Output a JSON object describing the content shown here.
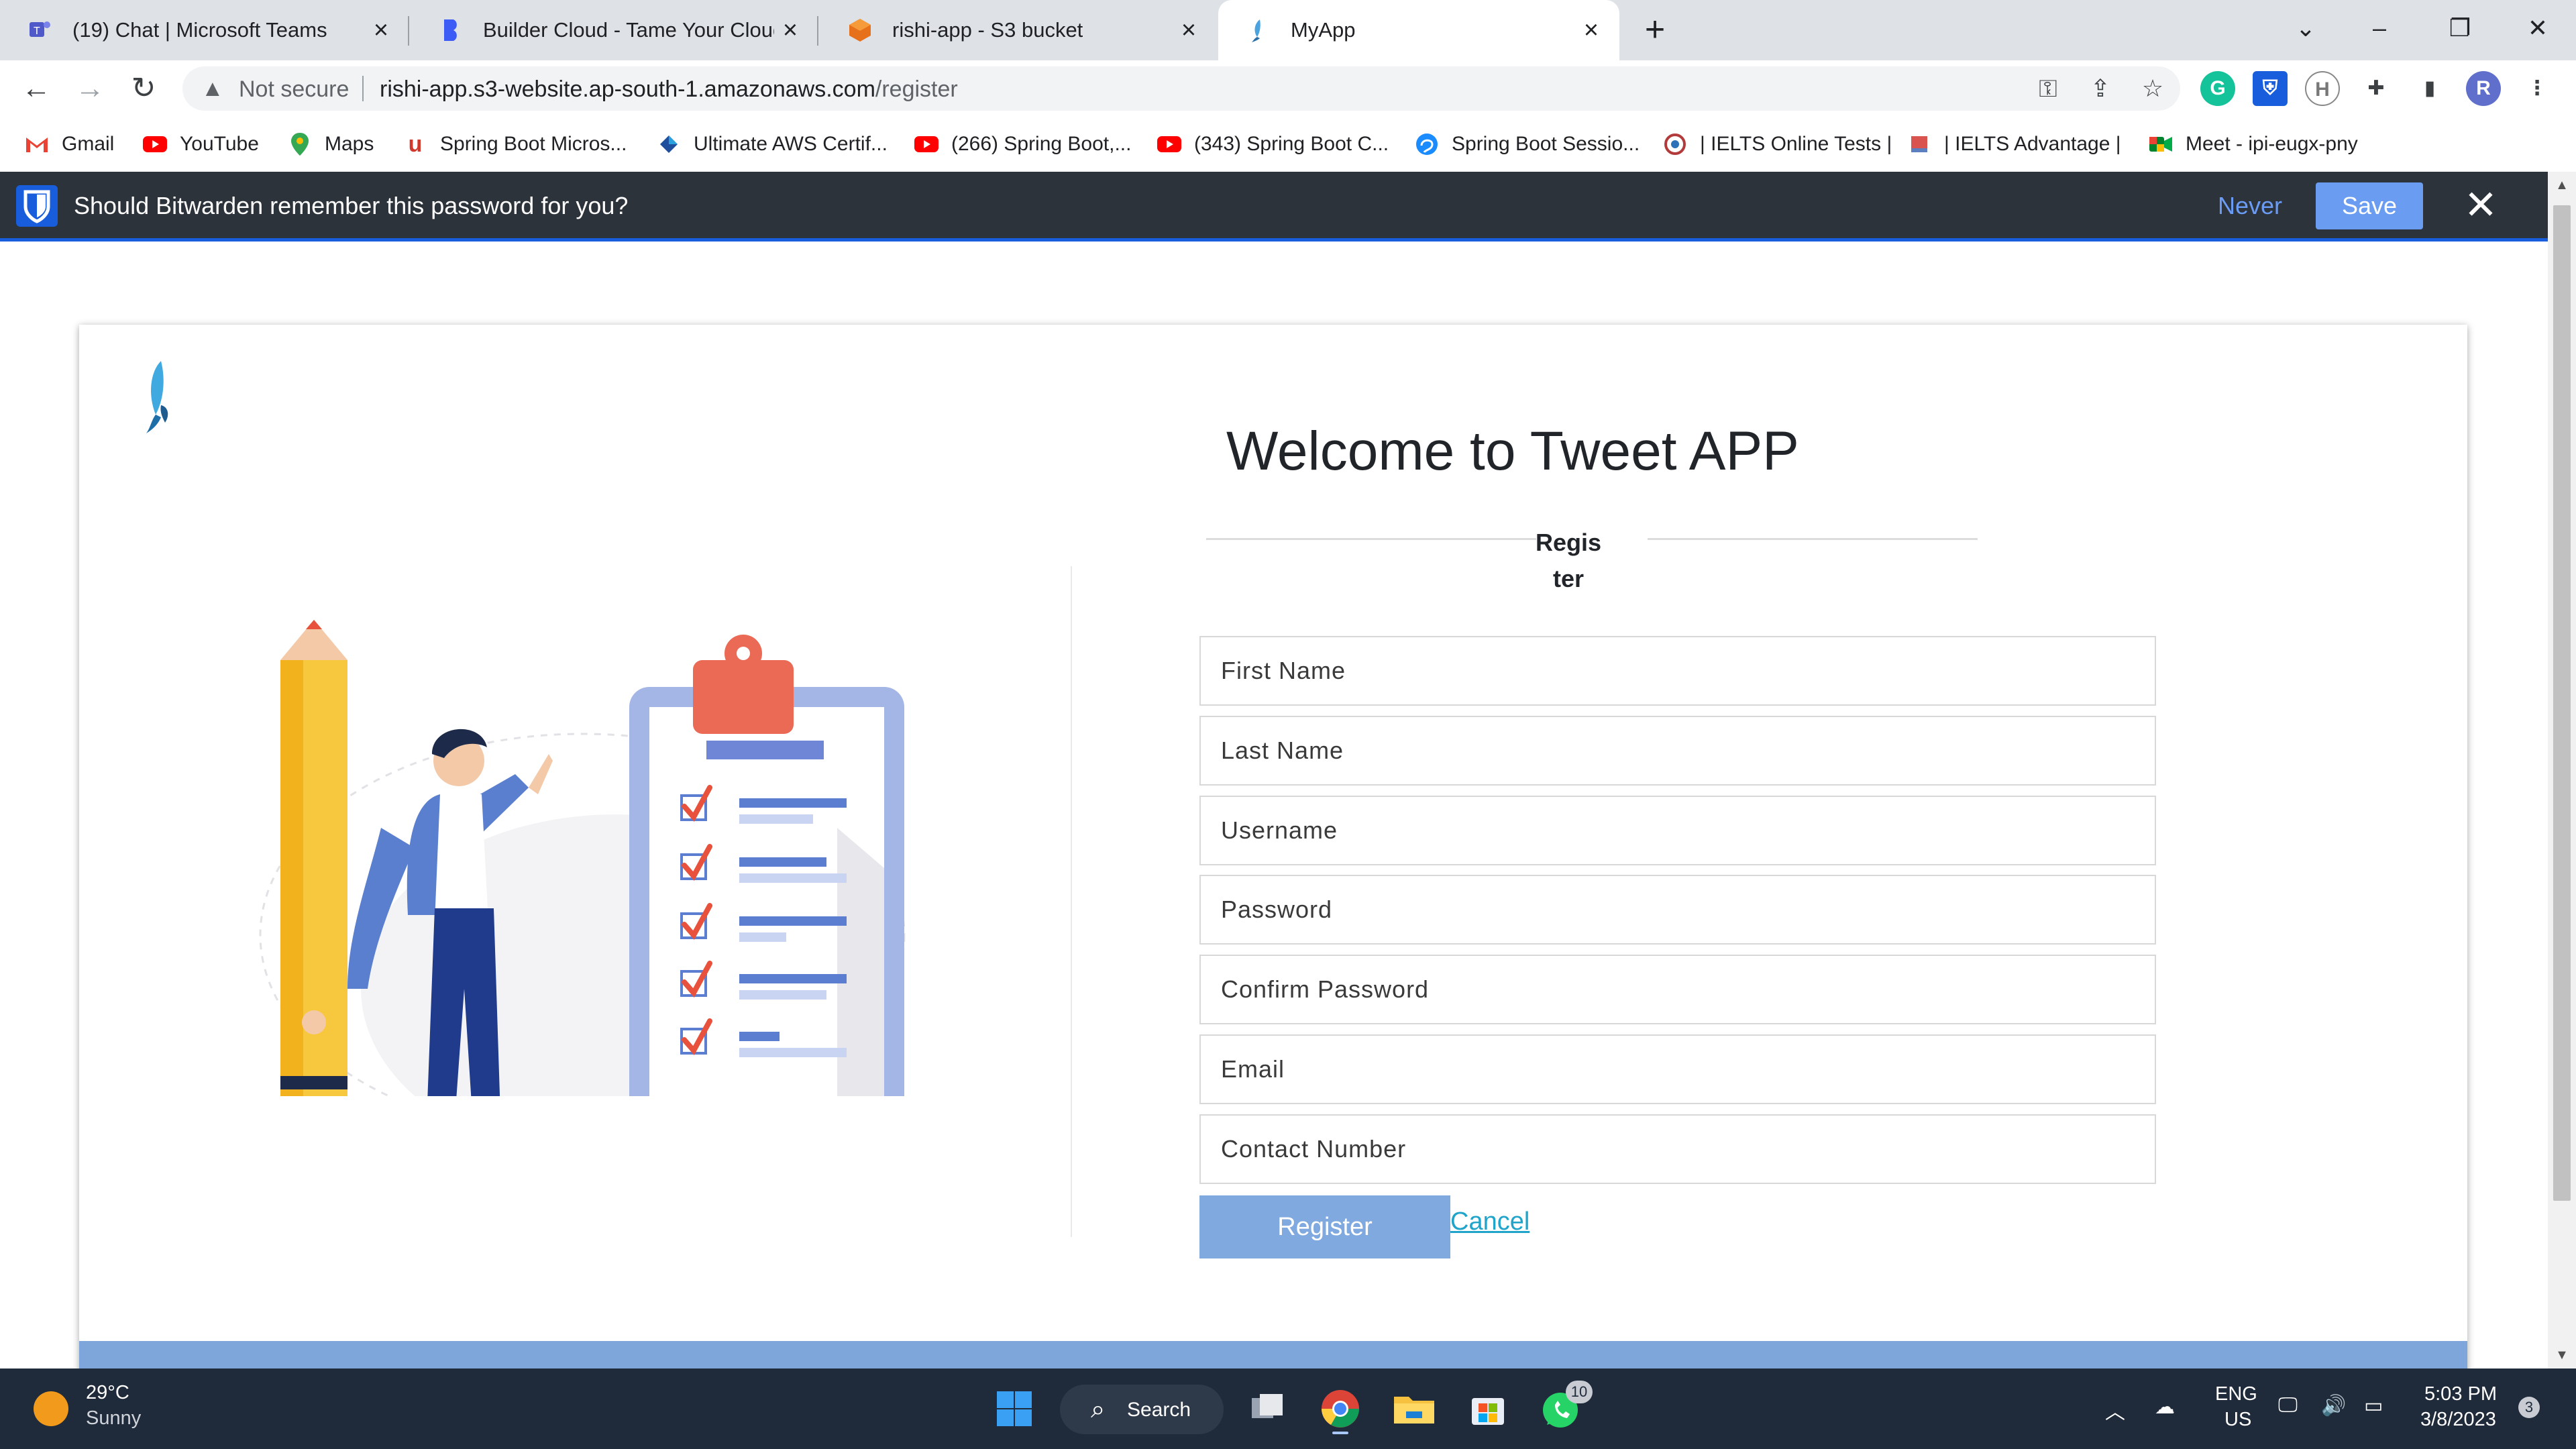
{
  "browser": {
    "tabs": [
      {
        "title": "(19) Chat | Microsoft Teams",
        "icon": "teams-icon"
      },
      {
        "title": "Builder Cloud - Tame Your Cloud",
        "icon": "builder-icon"
      },
      {
        "title": "rishi-app - S3 bucket",
        "icon": "aws-icon"
      },
      {
        "title": "MyApp",
        "icon": "bird-icon",
        "active": true
      }
    ],
    "new_tab": "+",
    "address": {
      "security": "Not secure",
      "host": "rishi-app.s3-website.ap-south-1.amazonaws.com",
      "path": "/register"
    },
    "profile_initial": "R",
    "bookmarks": [
      {
        "label": "Gmail",
        "icon": "gmail-icon"
      },
      {
        "label": "YouTube",
        "icon": "youtube-icon"
      },
      {
        "label": "Maps",
        "icon": "maps-icon"
      },
      {
        "label": "Spring Boot Micros...",
        "icon": "udemy-icon"
      },
      {
        "label": "Ultimate AWS Certif...",
        "icon": "aws-cert-icon"
      },
      {
        "label": "(266) Spring Boot,...",
        "icon": "youtube-icon"
      },
      {
        "label": "(343) Spring Boot C...",
        "icon": "youtube-icon"
      },
      {
        "label": "Spring Boot Sessio...",
        "icon": "brain-icon"
      },
      {
        "label": "| IELTS Online Tests |",
        "icon": "ielts-icon"
      },
      {
        "label": "| IELTS Advantage |",
        "icon": "ielts-icon"
      },
      {
        "label": "Meet - ipi-eugx-pny",
        "icon": "meet-icon"
      }
    ]
  },
  "bitwarden": {
    "message": "Should Bitwarden remember this password for you?",
    "never": "Never",
    "save": "Save",
    "close": "✕"
  },
  "page": {
    "heading": "Welcome to Tweet APP",
    "section": "Register",
    "fields": {
      "first_name": "First Name",
      "last_name": "Last Name",
      "username": "Username",
      "password": "Password",
      "confirm_password": "Confirm Password",
      "email": "Email",
      "contact": "Contact Number"
    },
    "register_button": "Register",
    "cancel_link": "Cancel"
  },
  "taskbar": {
    "weather_temp": "29°C",
    "weather_desc": "Sunny",
    "search": "Search",
    "whatsapp_badge": "10",
    "lang_1": "ENG",
    "lang_2": "US",
    "time": "5:03 PM",
    "date": "3/8/2023",
    "notif_count": "3"
  },
  "colors": {
    "bitwarden_blue": "#175ddc",
    "register_button": "#80a9df",
    "cancel_link": "#20a4c9",
    "footer_band": "#7fa6da"
  }
}
